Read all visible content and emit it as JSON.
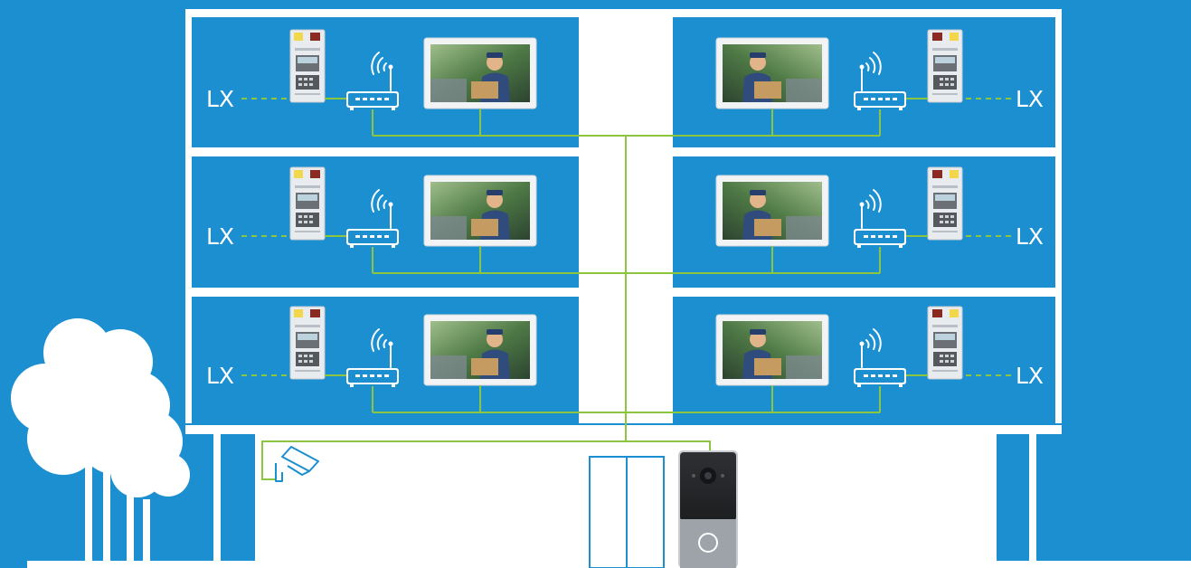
{
  "colors": {
    "background": "#1b8fd0",
    "building": "#ffffff",
    "wiring": "#8cc63f",
    "lan_dashes": "#8cc63f"
  },
  "diagram": {
    "floor_count": 3,
    "units_per_floor": 2,
    "unit_label": "LX",
    "unit_devices": [
      "lx-module",
      "network-switch",
      "wifi-signal-icon",
      "indoor-video-monitor"
    ],
    "ground_floor_devices": [
      "cctv-camera-icon",
      "entrance-door",
      "outdoor-door-station"
    ],
    "surroundings": [
      "tree-icon"
    ]
  }
}
